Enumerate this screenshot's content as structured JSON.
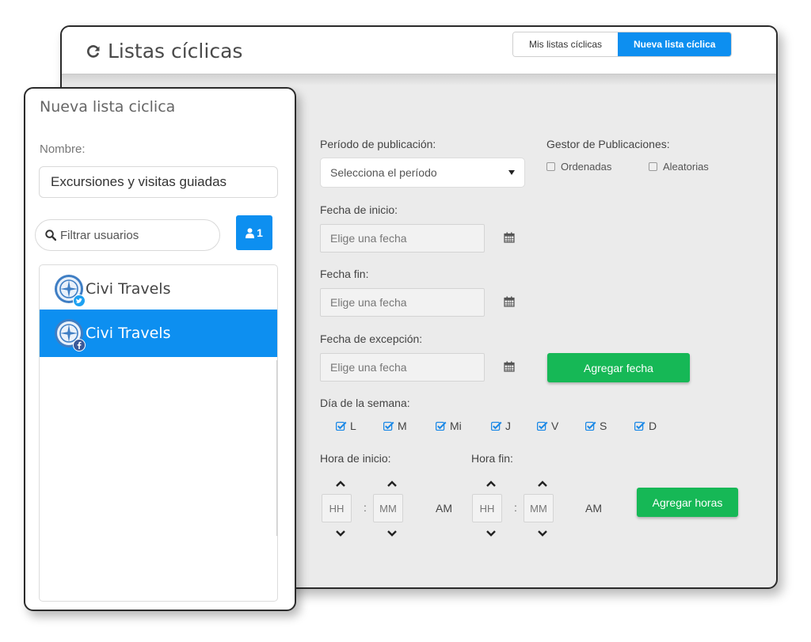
{
  "header": {
    "title": "Listas cíclicas",
    "tabs": [
      {
        "label": "Mis listas cíclicas"
      },
      {
        "label": "Nueva lista cíclica"
      }
    ]
  },
  "form": {
    "period": {
      "label": "Período de publicación:",
      "value": "Selecciona el período"
    },
    "publisher": {
      "label": "Gestor de Publicaciones:",
      "options": [
        {
          "label": "Ordenadas"
        },
        {
          "label": "Aleatorias"
        }
      ]
    },
    "start_date": {
      "label": "Fecha de inicio:",
      "placeholder": "Elige una fecha"
    },
    "end_date": {
      "label": "Fecha fin:",
      "placeholder": "Elige una fecha"
    },
    "exception_date": {
      "label": "Fecha de excepción:",
      "placeholder": "Elige una fecha"
    },
    "add_date_label": "Agregar fecha",
    "weekdays": {
      "label": "Día de la semana:",
      "days": [
        "L",
        "M",
        "Mi",
        "J",
        "V",
        "S",
        "D"
      ]
    },
    "start_time": {
      "label": "Hora de inicio:",
      "hh": "HH",
      "mm": "MM",
      "ampm": "AM"
    },
    "end_time": {
      "label": "Hora fin:",
      "hh": "HH",
      "mm": "MM",
      "ampm": "AM"
    },
    "time_separator": ":",
    "add_hours_label": "Agregar horas"
  },
  "panel": {
    "title": "Nueva lista ciclica",
    "name_label": "Nombre:",
    "name_value": "Excursiones y visitas guiadas",
    "filter_placeholder": "Filtrar usuarios",
    "user_count": "1",
    "users": [
      {
        "name": "Civi Travels",
        "network": "twitter-icon",
        "selected": false
      },
      {
        "name": "Civi Travels",
        "network": "facebook-icon",
        "selected": true
      }
    ]
  },
  "colors": {
    "primary": "#0d8ff0",
    "success": "#16b856",
    "background": "#ebebeb"
  }
}
